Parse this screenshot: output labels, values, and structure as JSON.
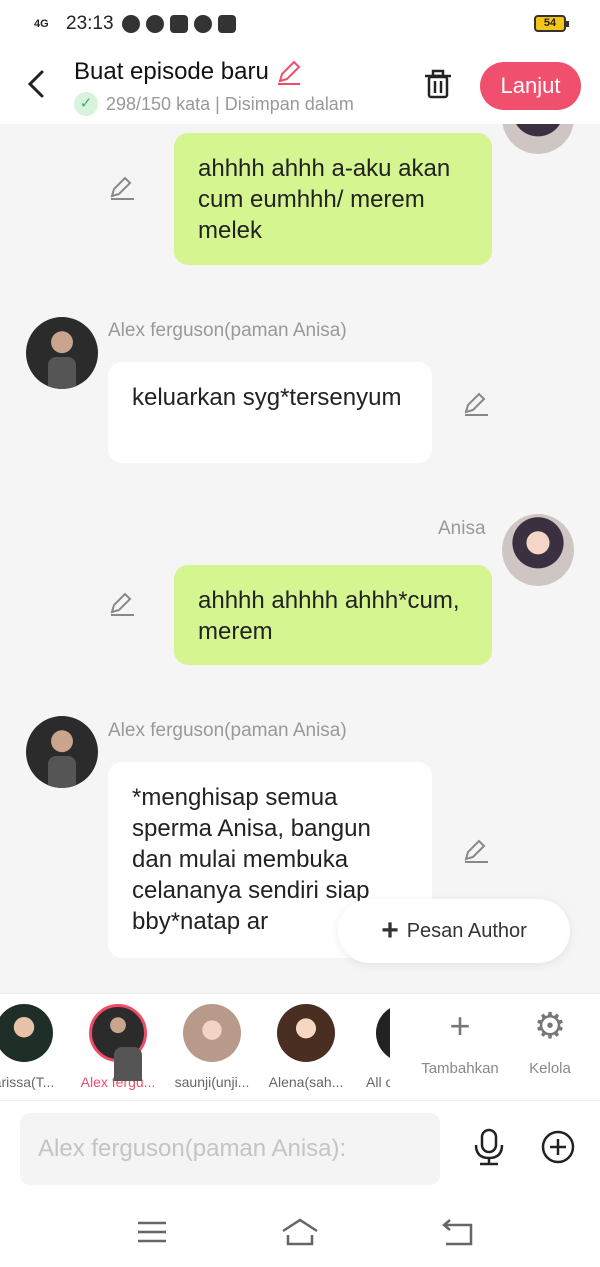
{
  "status_bar": {
    "network": "4G",
    "time": "23:13",
    "battery": "54"
  },
  "header": {
    "title": "Buat episode baru",
    "subtitle": "298/150 kata | Disimpan dalam",
    "next_label": "Lanjut"
  },
  "messages": [
    {
      "side": "me",
      "text": "ahhhh ahhh a-aku akan cum eumhhh/ merem melek"
    },
    {
      "side": "other",
      "sender": "Alex ferguson(paman Anisa)",
      "text": "keluarkan syg*tersenyum"
    },
    {
      "side": "me",
      "sender": "Anisa",
      "text": "ahhhh ahhhh ahhh*cum, merem"
    },
    {
      "side": "other",
      "sender": "Alex ferguson(paman Anisa)",
      "text": "*menghisap semua sperma Anisa, bangun dan mulai membuka celananya sendiri siap bby*natap ar"
    }
  ],
  "fab": {
    "label": "Pesan Author"
  },
  "characters": [
    {
      "label": "arissa(T..."
    },
    {
      "label": "Alex fergu...",
      "active": true
    },
    {
      "label": "saunji(unji..."
    },
    {
      "label": "Alena(sah..."
    },
    {
      "label": "All c"
    }
  ],
  "tools": {
    "add_label": "Tambahkan",
    "manage_label": "Kelola"
  },
  "input": {
    "placeholder": "Alex ferguson(paman Anisa):"
  },
  "colors": {
    "accent": "#f04f6d",
    "my_bubble": "#d4f590",
    "other_bubble": "#ffffff"
  }
}
